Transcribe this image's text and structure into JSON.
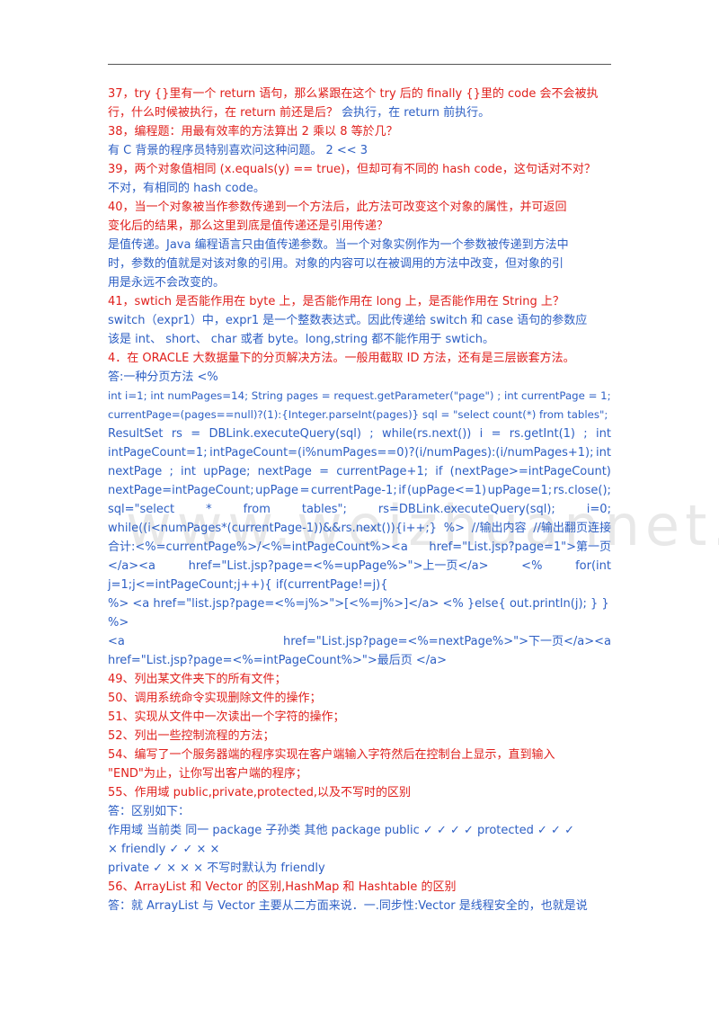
{
  "watermark": "www.weizhuannet.com",
  "lines": [
    {
      "type": "q",
      "text": "37，try  {}里有一个 return 语句，那么紧跟在这个 try 后的 finally  {}里的 code 会不会被执"
    },
    {
      "type": "mixed",
      "q": "行，什么时候被执行，在 return 前还是后？",
      "a": "会执行，在 return 前执行。"
    },
    {
      "type": "q",
      "text": "38，编程题：用最有效率的方法算出 2 乘以 8 等於几？"
    },
    {
      "type": "a",
      "text": "有 C 背景的程序员特别喜欢问这种问题。  2 << 3"
    },
    {
      "type": "q",
      "text": "39，两个对象值相同 (x.equals(y) == true)，但却可有不同的 hash code，这句话对不对？"
    },
    {
      "type": "a",
      "text": "不对，有相同的 hash code。"
    },
    {
      "type": "q",
      "text": "40，当一个对象被当作参数传递到一个方法后，此方法可改变这个对象的属性，并可返回"
    },
    {
      "type": "q",
      "text": "变化后的结果，那么这里到底是值传递还是引用传递？"
    },
    {
      "type": "a",
      "text": "是值传递。Java  编程语言只由值传递参数。当一个对象实例作为一个参数被传递到方法中"
    },
    {
      "type": "a",
      "text": "时，参数的值就是对该对象的引用。对象的内容可以在被调用的方法中改变，但对象的引"
    },
    {
      "type": "a",
      "text": "用是永远不会改变的。"
    },
    {
      "type": "q",
      "text": "41，swtich 是否能作用在 byte 上，是否能作用在 long 上，是否能作用在 String 上？"
    },
    {
      "type": "a",
      "text": "switch（expr1）中，expr1 是一个整数表达式。因此传递给  switch  和  case  语句的参数应"
    },
    {
      "type": "a",
      "text": "该是  int、  short、  char  或者  byte。long,string  都不能作用于 swtich。"
    },
    {
      "type": "q",
      "text": "4．在 ORACLE 大数据量下的分页解决方法。一般用截取 ID 方法，还有是三层嵌套方法。"
    },
    {
      "type": "a",
      "text": "答:一种分页方法  <%"
    },
    {
      "type": "a",
      "text": "int i=1; int numPages=14; String pages = request.getParameter(\"page\") ; int currentPage = 1;"
    },
    {
      "type": "a",
      "text": "currentPage=(pages==null)?(1):{Integer.parseInt(pages)} sql = \"select count(*) from tables\";"
    },
    {
      "type": "aj",
      "parts": [
        "ResultSet",
        "rs",
        "=",
        "DBLink.executeQuery(sql)",
        ";",
        "while(rs.next())",
        "i",
        "=",
        "rs.getInt(1)",
        ";",
        "int"
      ]
    },
    {
      "type": "aj",
      "parts": [
        "intPageCount=1;",
        "intPageCount=(i%numPages==0)?(i/numPages):(i/numPages+1);",
        "int"
      ]
    },
    {
      "type": "aj",
      "parts": [
        "nextPage",
        ";",
        "int",
        "upPage;",
        "nextPage",
        "=",
        "currentPage+1;",
        "if",
        "(nextPage>=intPageCount)"
      ]
    },
    {
      "type": "aj",
      "parts": [
        "nextPage=intPageCount;",
        "upPage",
        "=",
        "currentPage-1;",
        "if",
        "(upPage<=1)",
        "upPage=1;",
        "rs.close();"
      ]
    },
    {
      "type": "aj",
      "parts": [
        "sql=\"select",
        "*",
        "from",
        "tables\";",
        "rs=DBLink.executeQuery(sql);",
        "i=0;"
      ]
    },
    {
      "type": "aj",
      "parts": [
        "while((i<numPages*(currentPage-1))&&rs.next()){i++;}",
        "%>",
        "//输出内容",
        "//输出翻页连接"
      ]
    },
    {
      "type": "aj",
      "parts": [
        "合计:<%=currentPage%>/<%=intPageCount%><a",
        "href=\"List.jsp?page=1\">第一页"
      ]
    },
    {
      "type": "aj",
      "parts": [
        "</a><a",
        "href=\"List.jsp?page=<%=upPage%>\">上一页</a>",
        "<%",
        "for(int"
      ]
    },
    {
      "type": "a",
      "text": "j=1;j<=intPageCount;j++){ if(currentPage!=j){"
    },
    {
      "type": "a",
      "text": "%>  <a href=\"list.jsp?page=<%=j%>\">[<%=j%>]</a>  <% }else{ out.println(j); } }"
    },
    {
      "type": "a",
      "text": "%>"
    },
    {
      "type": "aj",
      "parts": [
        "<a",
        "href=\"List.jsp?page=<%=nextPage%>\">下一页</a><a"
      ]
    },
    {
      "type": "a",
      "text": "href=\"List.jsp?page=<%=intPageCount%>\">最后页  </a>"
    },
    {
      "type": "q",
      "text": "49、列出某文件夹下的所有文件；"
    },
    {
      "type": "q",
      "text": "50、调用系统命令实现删除文件的操作；"
    },
    {
      "type": "q",
      "text": "51、实现从文件中一次读出一个字符的操作；"
    },
    {
      "type": "q",
      "text": "52、列出一些控制流程的方法；"
    },
    {
      "type": "q",
      "text": "54、编写了一个服务器端的程序实现在客户端输入字符然后在控制台上显示，直到输入"
    },
    {
      "type": "q",
      "text": "\"END\"为止，让你写出客户端的程序；"
    },
    {
      "type": "q",
      "text": "55、作用域 public,private,protected,以及不写时的区别"
    },
    {
      "type": "a",
      "text": "答：区别如下："
    },
    {
      "type": "a",
      "text": "作用域  当前类  同一 package  子孙类  其他 package public ✓ ✓ ✓ ✓ protected ✓ ✓ ✓"
    },
    {
      "type": "a",
      "text": "× friendly ✓ ✓ × ×"
    },
    {
      "type": "a",
      "text": "private ✓ × × ×  不写时默认为 friendly"
    },
    {
      "type": "q",
      "text": "56、ArrayList 和 Vector 的区别,HashMap 和 Hashtable 的区别"
    },
    {
      "type": "a",
      "text": "答：就 ArrayList 与 Vector 主要从二方面来说．一.同步性:Vector 是线程安全的，也就是说"
    }
  ]
}
